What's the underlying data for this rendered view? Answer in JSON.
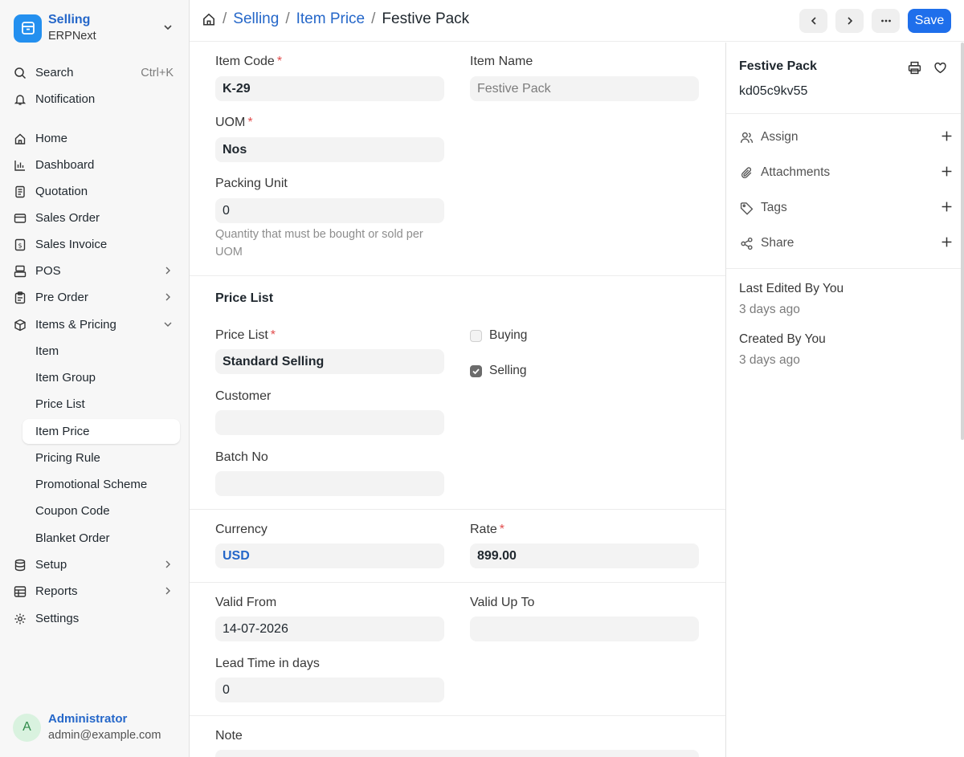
{
  "app": {
    "title": "Selling",
    "subtitle": "ERPNext"
  },
  "sidebar": {
    "search": {
      "label": "Search",
      "shortcut": "Ctrl+K"
    },
    "notification": "Notification",
    "items": [
      {
        "label": "Home",
        "icon": "home-icon"
      },
      {
        "label": "Dashboard",
        "icon": "bar-chart-icon"
      },
      {
        "label": "Quotation",
        "icon": "document-icon"
      },
      {
        "label": "Sales Order",
        "icon": "credit-card-icon"
      },
      {
        "label": "Sales Invoice",
        "icon": "invoice-icon"
      },
      {
        "label": "POS",
        "icon": "pos-icon"
      },
      {
        "label": "Pre Order",
        "icon": "clipboard-icon"
      },
      {
        "label": "Items & Pricing",
        "icon": "box-icon"
      }
    ],
    "children": [
      {
        "label": "Item"
      },
      {
        "label": "Item Group"
      },
      {
        "label": "Price List"
      },
      {
        "label": "Item Price"
      },
      {
        "label": "Pricing Rule"
      },
      {
        "label": "Promotional Scheme"
      },
      {
        "label": "Coupon Code"
      },
      {
        "label": "Blanket Order"
      }
    ],
    "bottom_items": [
      {
        "label": "Setup",
        "icon": "database-icon"
      },
      {
        "label": "Reports",
        "icon": "table-icon"
      },
      {
        "label": "Settings",
        "icon": "gear-icon"
      }
    ],
    "active_child": "Item Price"
  },
  "user": {
    "initial": "A",
    "name": "Administrator",
    "email": "admin@example.com"
  },
  "breadcrumb": {
    "module": "Selling",
    "doctype": "Item Price",
    "current": "Festive Pack"
  },
  "toolbar": {
    "save_label": "Save"
  },
  "form": {
    "item_code": {
      "label": "Item Code",
      "value": "K-29"
    },
    "item_name": {
      "label": "Item Name",
      "value": "Festive Pack"
    },
    "uom": {
      "label": "UOM",
      "value": "Nos"
    },
    "packing_unit": {
      "label": "Packing Unit",
      "value": "0",
      "help": "Quantity that must be bought or sold per UOM"
    },
    "price_list_section": "Price List",
    "price_list": {
      "label": "Price List",
      "value": "Standard Selling"
    },
    "buying": {
      "label": "Buying",
      "checked": false
    },
    "selling": {
      "label": "Selling",
      "checked": true
    },
    "customer": {
      "label": "Customer",
      "value": ""
    },
    "batch_no": {
      "label": "Batch No",
      "value": ""
    },
    "currency": {
      "label": "Currency",
      "value": "USD"
    },
    "rate": {
      "label": "Rate",
      "value": "899.00"
    },
    "valid_from": {
      "label": "Valid From",
      "value": "14-07-2026"
    },
    "valid_upto": {
      "label": "Valid Up To",
      "value": ""
    },
    "lead_time": {
      "label": "Lead Time in days",
      "value": "0"
    },
    "note": {
      "label": "Note"
    },
    "required_mark": "*"
  },
  "panel": {
    "title": "Festive Pack",
    "doc_id": "kd05c9kv55",
    "actions": [
      {
        "label": "Assign",
        "icon": "user-icon"
      },
      {
        "label": "Attachments",
        "icon": "paperclip-icon"
      },
      {
        "label": "Tags",
        "icon": "tag-icon"
      },
      {
        "label": "Share",
        "icon": "share-icon"
      }
    ],
    "last_edited": "Last Edited By You",
    "last_edited_time": "3 days ago",
    "created": "Created By You",
    "created_time": "3 days ago"
  }
}
